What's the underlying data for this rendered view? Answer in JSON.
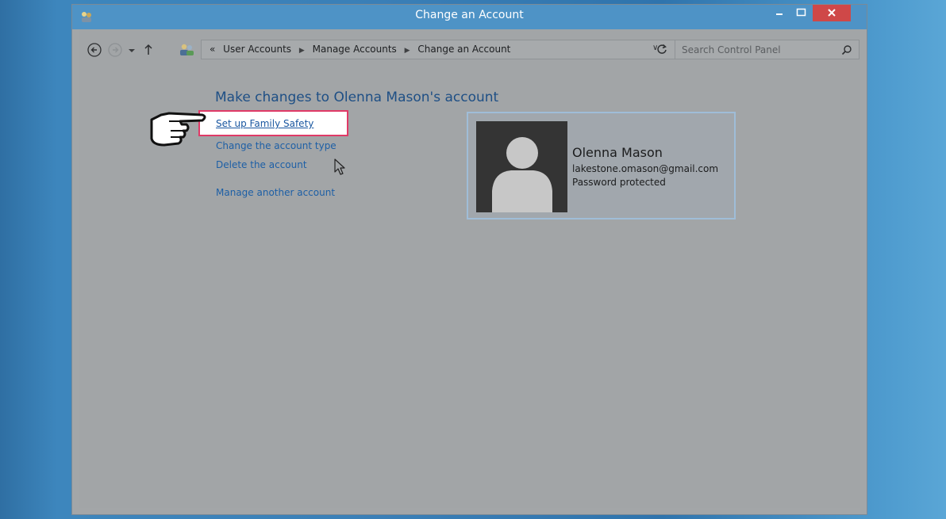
{
  "window": {
    "title": "Change an Account"
  },
  "address_bar": {
    "overflow": "«",
    "crumbs": [
      "User Accounts",
      "Manage Accounts",
      "Change an Account"
    ]
  },
  "search": {
    "placeholder": "Search Control Panel"
  },
  "main": {
    "heading": "Make changes to Olenna Mason's account",
    "links": {
      "family_safety": "Set up Family Safety",
      "change_type": "Change the account type",
      "delete": "Delete the account",
      "manage_another": "Manage another account"
    }
  },
  "account": {
    "name": "Olenna Mason",
    "email": "lakestone.omason@gmail.com",
    "status": "Password protected"
  },
  "colors": {
    "titlebar": "#4e93c6",
    "close_button": "#cf4848",
    "highlight_border": "#e03a67",
    "link": "#1d5fa6"
  }
}
